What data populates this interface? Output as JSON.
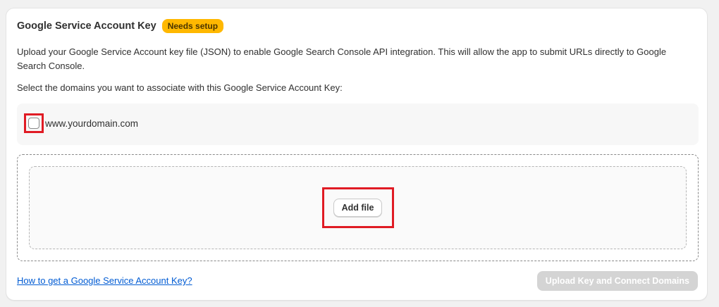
{
  "card": {
    "title": "Google Service Account Key",
    "badge": "Needs setup",
    "description": "Upload your Google Service Account key file (JSON) to enable Google Search Console API integration. This will allow the app to submit URLs directly to Google Search Console.",
    "select_label": "Select the domains you want to associate with this Google Service Account Key:"
  },
  "domains": [
    {
      "label": "www.yourdomain.com",
      "checked": false
    }
  ],
  "dropzone": {
    "add_file_label": "Add file"
  },
  "footer": {
    "help_link": "How to get a Google Service Account Key?",
    "submit_label": "Upload Key and Connect Domains",
    "submit_disabled": true
  },
  "colors": {
    "badge_bg": "#ffb800",
    "link": "#005bd3",
    "highlight": "#e01b24",
    "disabled_button": "#d4d4d4"
  }
}
